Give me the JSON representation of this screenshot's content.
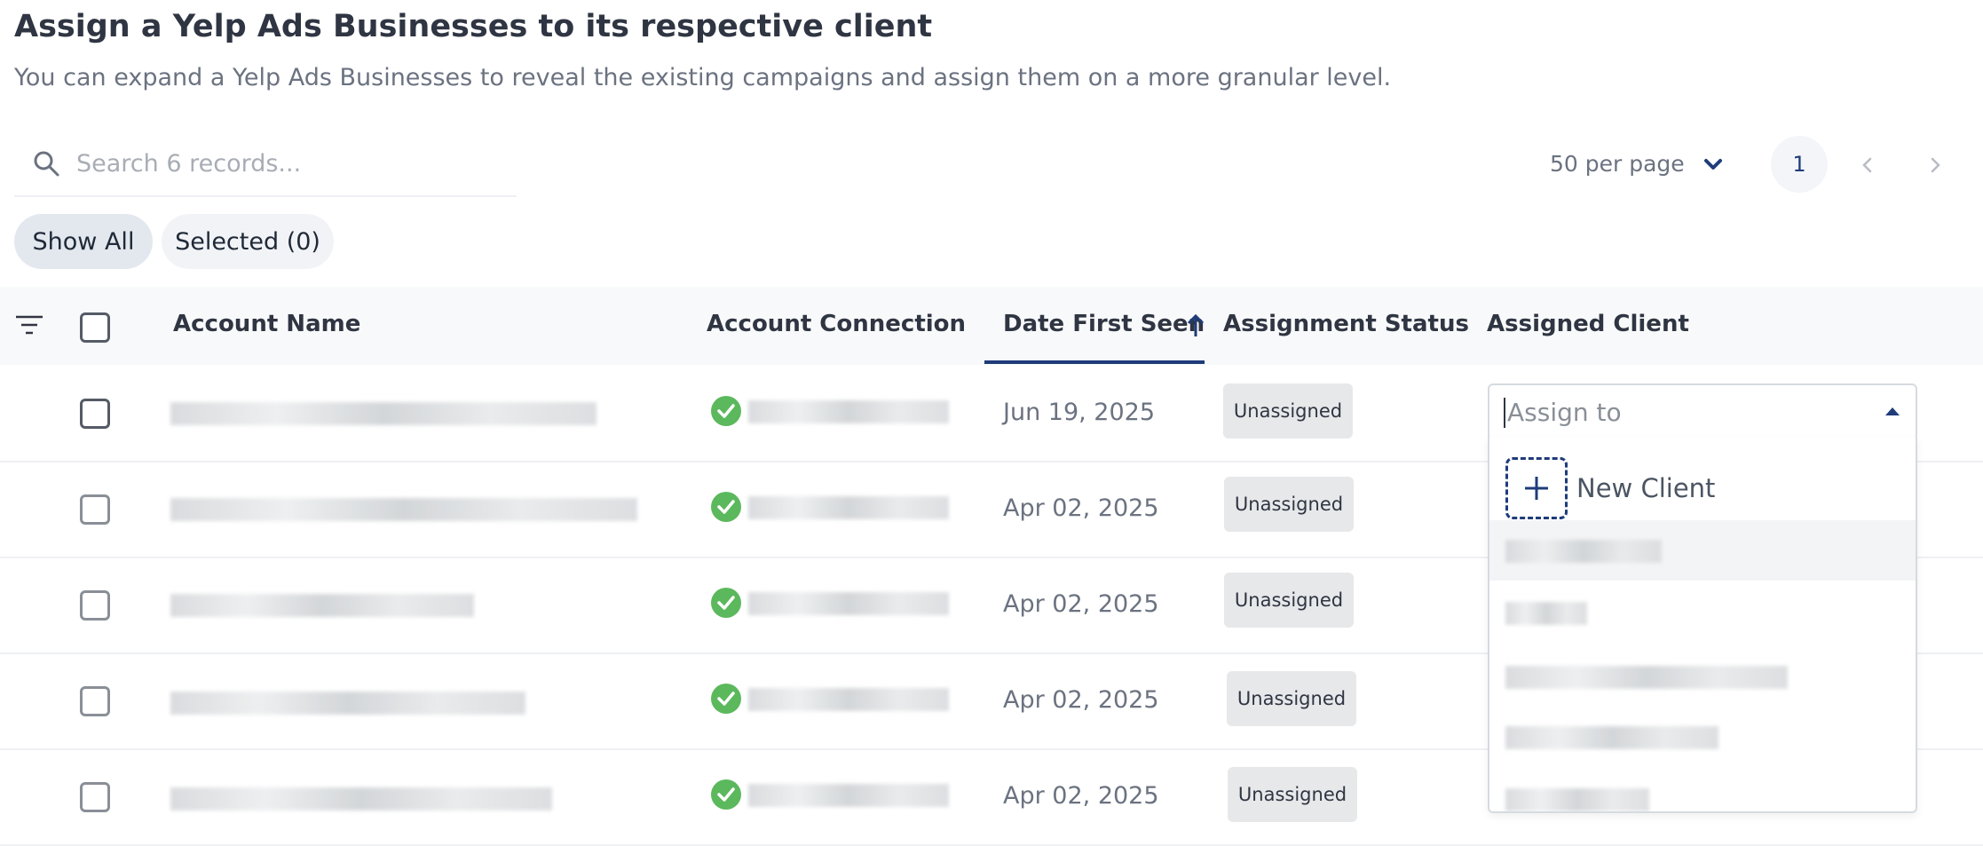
{
  "header": {
    "title": "Assign a Yelp Ads Businesses to its respective client",
    "subtitle": "You can expand a Yelp Ads Businesses to reveal the existing campaigns and assign them on a more granular level."
  },
  "search": {
    "placeholder": "Search 6 records..."
  },
  "pagination": {
    "per_page_label": "50 per page",
    "current_page": "1"
  },
  "filters": {
    "show_all": "Show All",
    "selected": "Selected (0)"
  },
  "table": {
    "columns": {
      "account_name": "Account Name",
      "account_connection": "Account Connection",
      "date_first_seen": "Date First Seen",
      "assignment_status": "Assignment Status",
      "assigned_client": "Assigned Client"
    },
    "sort": {
      "column": "Date First Seen",
      "direction": "ascending"
    },
    "rows": [
      {
        "date": "Jun 19, 2025",
        "status": "Unassigned"
      },
      {
        "date": "Apr 02, 2025",
        "status": "Unassigned"
      },
      {
        "date": "Apr 02, 2025",
        "status": "Unassigned"
      },
      {
        "date": "Apr 02, 2025",
        "status": "Unassigned"
      },
      {
        "date": "Apr 02, 2025",
        "status": "Unassigned"
      }
    ]
  },
  "assign": {
    "placeholder": "Assign to",
    "new_client_label": "New Client"
  },
  "colors": {
    "accent": "#1f3c7a",
    "success": "#5cb85c",
    "header_bg": "#f8f9fa",
    "badge_bg": "#e7e8ea"
  },
  "icons": [
    "search-icon",
    "chevron-down-icon",
    "chevron-left-icon",
    "chevron-right-icon",
    "filter-icon",
    "arrow-up-icon",
    "check-circle-icon",
    "caret-up-icon",
    "plus-icon"
  ]
}
